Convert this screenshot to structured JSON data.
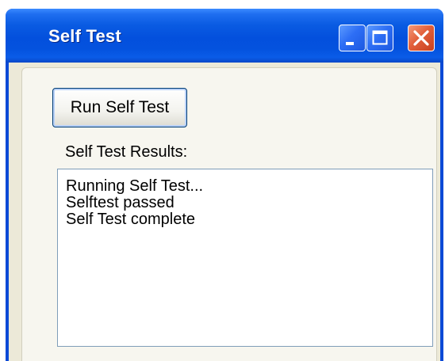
{
  "window": {
    "title": "Self Test",
    "controls": {
      "minimize": "minimize-icon",
      "maximize": "maximize-icon",
      "close": "close-icon"
    }
  },
  "main": {
    "run_button_label": "Run Self Test",
    "results_label": "Self Test Results:",
    "results_lines": [
      "Running Self Test...",
      "Selftest passed",
      "Self Test complete"
    ]
  },
  "colors": {
    "titlebar": "#0a5be2",
    "close_button": "#e2603b",
    "client_background": "#ece9d8",
    "field_border": "#7f9db9"
  }
}
